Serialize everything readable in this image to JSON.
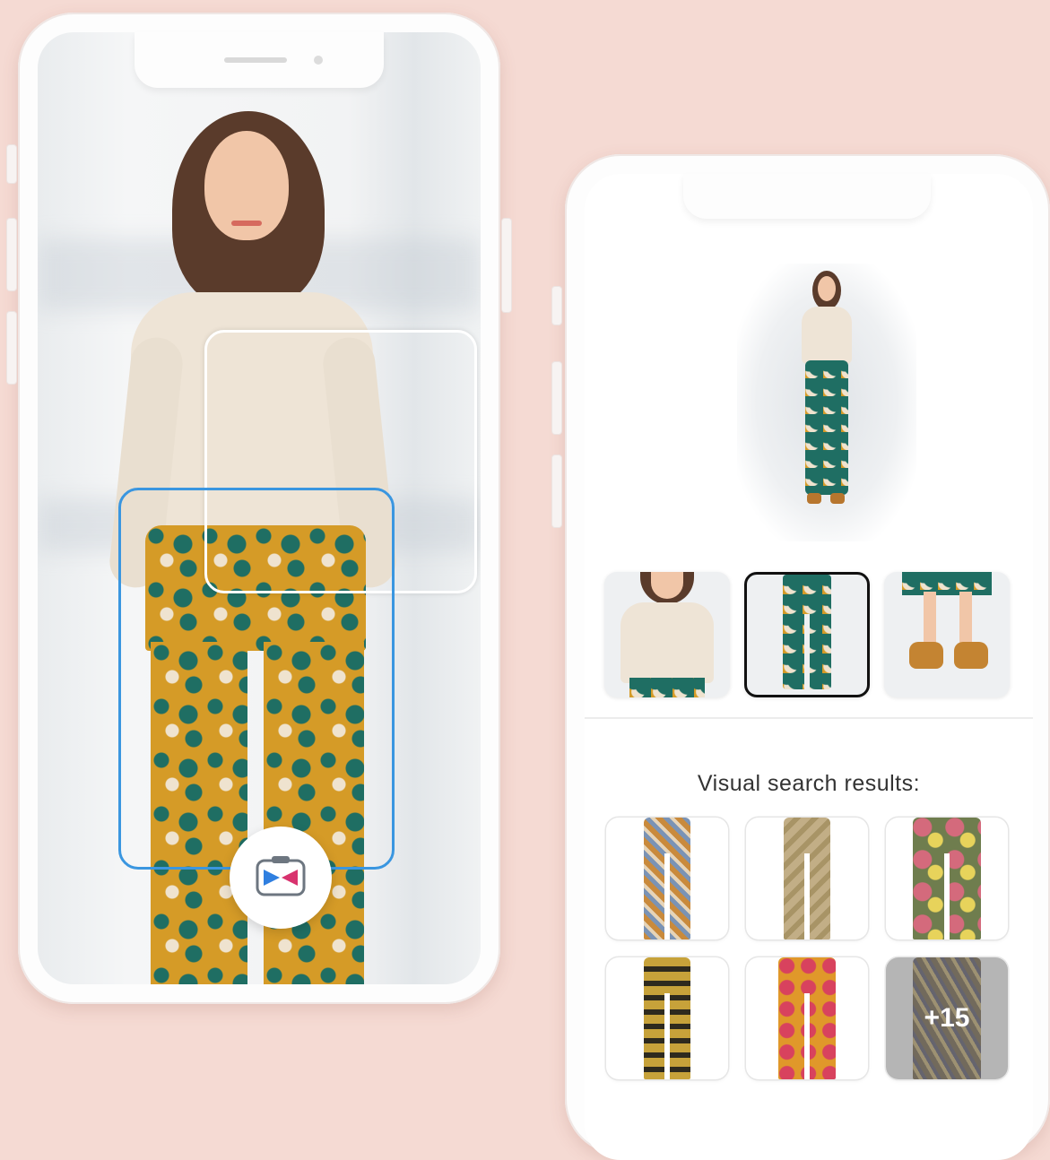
{
  "results": {
    "label": "Visual search results:",
    "more_count": "+15"
  },
  "icons": {
    "camera": "camera-icon"
  },
  "colors": {
    "background": "#f5dad3",
    "selection_active": "#3a96e0",
    "selection_inactive": "#ffffff",
    "thumb_selected_border": "#111111"
  }
}
